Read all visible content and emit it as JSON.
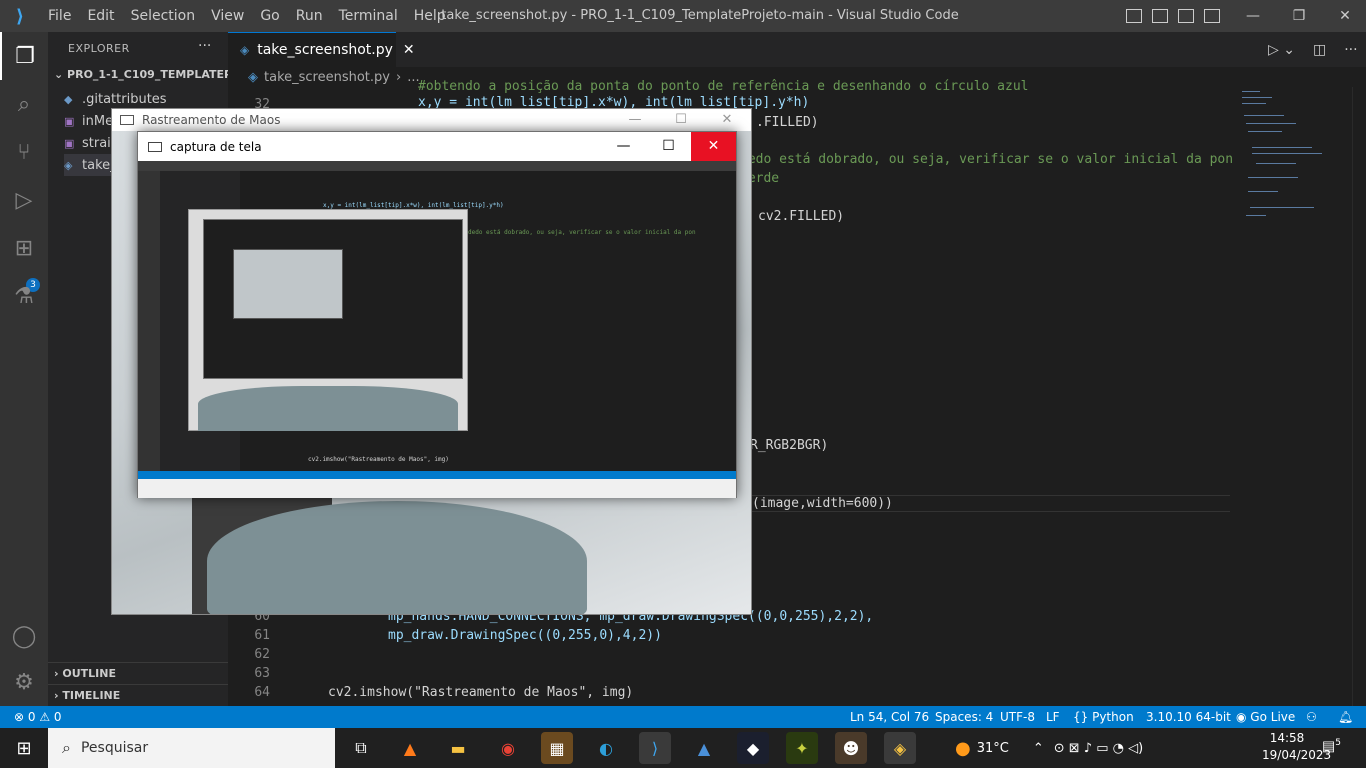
{
  "app": {
    "window_title": "take_screenshot.py - PRO_1-1_C109_TemplateProjeto-main - Visual Studio Code",
    "menu": [
      "File",
      "Edit",
      "Selection",
      "View",
      "Go",
      "Run",
      "Terminal",
      "Help"
    ]
  },
  "sidebar": {
    "header": "EXPLORER",
    "more": "···",
    "folder": "PRO_1-1_C109_TEMPLATEPR...",
    "files": [
      {
        "name": ".gitattributes",
        "icon": "git-icon"
      },
      {
        "name": "inMe",
        "icon": "image-icon"
      },
      {
        "name": "straig",
        "icon": "image-icon"
      },
      {
        "name": "take_",
        "icon": "python-icon"
      }
    ],
    "outline": "OUTLINE",
    "timeline": "TIMELINE",
    "badge": "3"
  },
  "editor": {
    "tab": "take_screenshot.py",
    "tab_close": "✕",
    "breadcrumb_file": "take_screenshot.py",
    "breadcrumb_more": "...",
    "lines": [
      {
        "n": "",
        "text": "#obtendo a posição da ponta do ponto de referência e desenhando o círculo azul"
      },
      {
        "n": "32",
        "text": "x,y = int(lm_list[tip].x*w), int(lm_list[tip].y*h)"
      },
      {
        "n": "",
        "text": ".FILLED)"
      },
      {
        "n": "",
        "text": "dedo está dobrado, ou seja, verificar se o valor inicial da pon"
      },
      {
        "n": "",
        "text": "verde"
      },
      {
        "n": "",
        "text": "cv2.FILLED)"
      },
      {
        "n": "",
        "text": "R_RGB2BGR)"
      },
      {
        "n": "",
        "text": "(image,width=600))"
      },
      {
        "n": "60",
        "text": "mp_hands.HAND_CONNECTIONS, mp_draw.DrawingSpec((0,0,255),2,2),"
      },
      {
        "n": "61",
        "text": "mp_draw.DrawingSpec((0,255,0),4,2))"
      },
      {
        "n": "62",
        "text": ""
      },
      {
        "n": "63",
        "text": ""
      },
      {
        "n": "64",
        "text": "cv2.imshow(\"Rastreamento de Maos\", img)"
      }
    ]
  },
  "windows": {
    "rastreamento_title": "Rastreamento de Maos",
    "captura_title": "captura de tela",
    "min": "—",
    "max": "☐",
    "close": "✕"
  },
  "statusbar": {
    "errors": "⊗ 0 ⚠ 0",
    "position": "Ln 54, Col 76",
    "spaces": "Spaces: 4",
    "encoding": "UTF-8",
    "eol": "LF",
    "language": "{} Python",
    "interpreter": "3.10.10 64-bit",
    "golive": "Go Live"
  },
  "taskbar": {
    "search_placeholder": "Pesquisar",
    "weather": "31°C",
    "time": "14:58",
    "date": "19/04/2023",
    "notifications": "5"
  }
}
